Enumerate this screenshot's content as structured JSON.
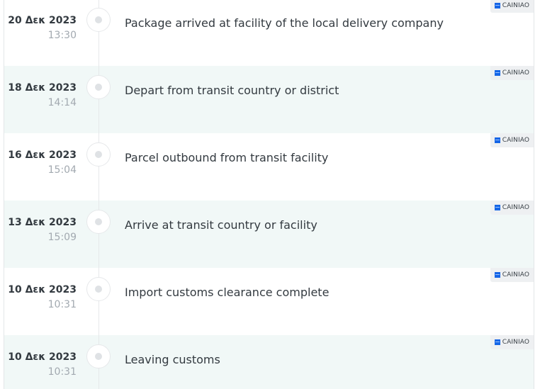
{
  "events": [
    {
      "date": "20 Δεκ 2023",
      "time": "13:30",
      "description": "Package arrived at facility of the local delivery company",
      "carrier": "CAINIAO"
    },
    {
      "date": "18 Δεκ 2023",
      "time": "14:14",
      "description": "Depart from transit country or district",
      "carrier": "CAINIAO"
    },
    {
      "date": "16 Δεκ 2023",
      "time": "15:04",
      "description": "Parcel outbound from transit facility",
      "carrier": "CAINIAO"
    },
    {
      "date": "13 Δεκ 2023",
      "time": "15:09",
      "description": "Arrive at transit country or facility",
      "carrier": "CAINIAO"
    },
    {
      "date": "10 Δεκ 2023",
      "time": "10:31",
      "description": "Import customs clearance complete",
      "carrier": "CAINIAO"
    },
    {
      "date": "10 Δεκ 2023",
      "time": "10:31",
      "description": "Leaving customs",
      "carrier": "CAINIAO"
    }
  ],
  "colors": {
    "alt_row_background": "#f1f8f7",
    "carrier_logo": "#1565e6",
    "text_primary": "#333a40",
    "text_muted": "#a2a9b0"
  },
  "icons": {
    "timeline_marker": "timeline-dot-icon",
    "carrier_logo": "cainiao-logo-icon"
  }
}
